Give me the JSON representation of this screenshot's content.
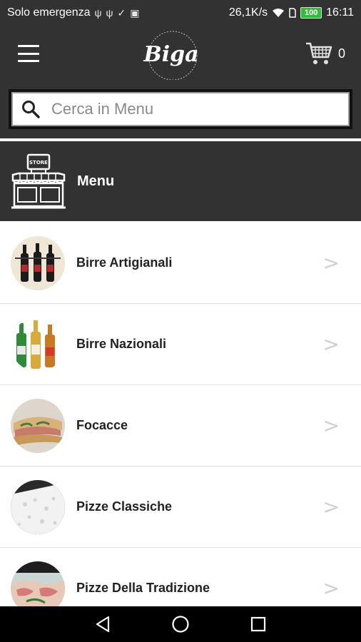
{
  "status_bar": {
    "carrier": "Solo emergenza",
    "left_icons": [
      "usb-icon",
      "usb-icon",
      "check-download-icon",
      "image-icon"
    ],
    "speed": "26,1K/s",
    "right_icons": [
      "wifi-icon",
      "sim-icon"
    ],
    "battery": "100",
    "time": "16:11"
  },
  "header": {
    "logo_text": "Biga",
    "cart_count": "0",
    "search_placeholder": "Cerca in Menu"
  },
  "banner": {
    "title": "Menu",
    "store_sign": "STORE"
  },
  "categories": [
    {
      "label": "Birre Artigianali",
      "chevron": ">"
    },
    {
      "label": "Birre Nazionali",
      "chevron": ">"
    },
    {
      "label": "Focacce",
      "chevron": ">"
    },
    {
      "label": "Pizze Classiche",
      "chevron": ">"
    },
    {
      "label": "Pizze Della Tradizione",
      "chevron": ">"
    }
  ],
  "colors": {
    "header_bg": "#323232",
    "battery": "#2bbf3a",
    "chevron": "#cfcfcf"
  }
}
